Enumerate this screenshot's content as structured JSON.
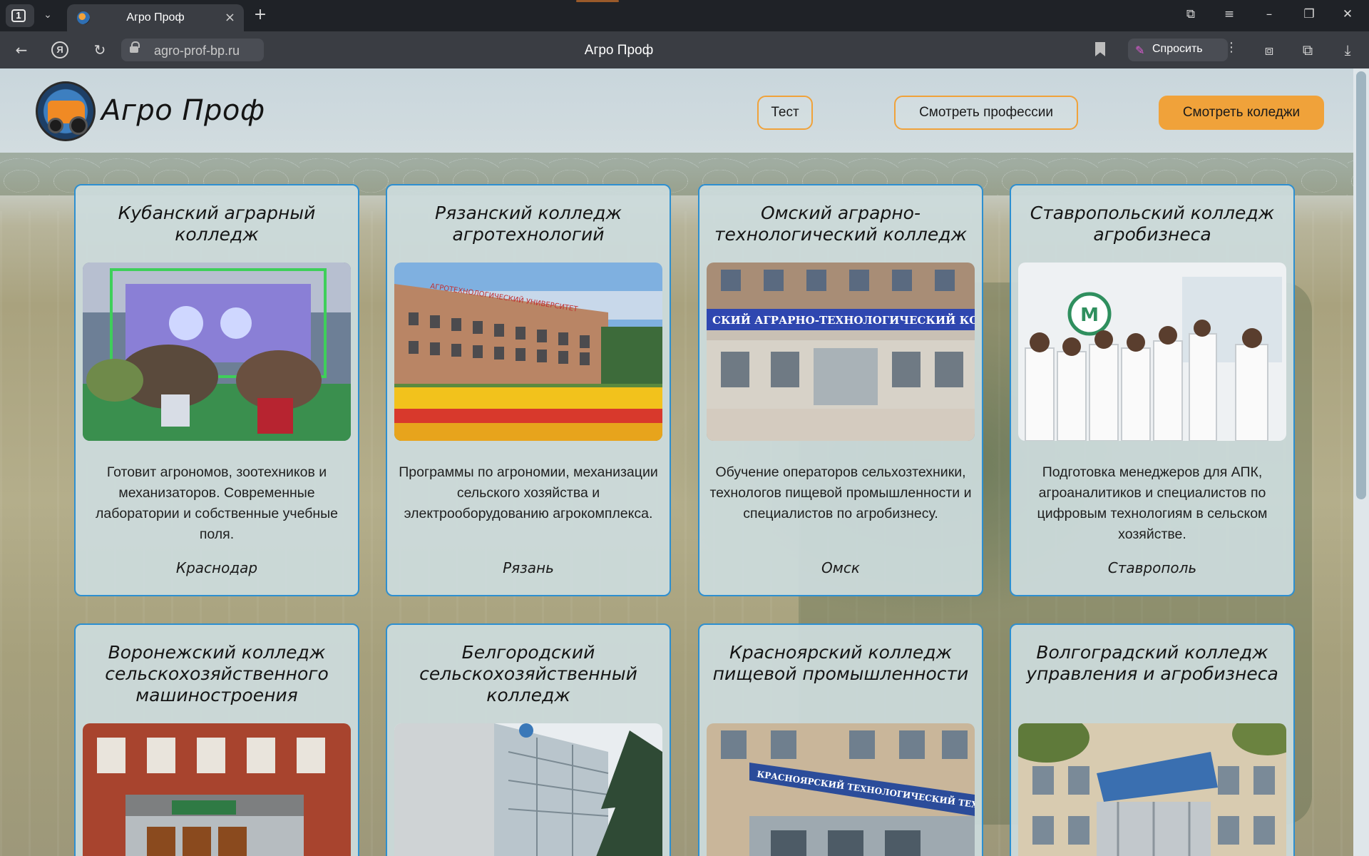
{
  "browser": {
    "tab_count": "1",
    "tab_title": "Агро Проф",
    "url": "agro-prof-bp.ru",
    "page_title": "Агро Проф",
    "ask_label": "Спросить"
  },
  "site": {
    "brand": "Агро Проф",
    "nav": {
      "test": "Тест",
      "professions": "Смотреть профессии",
      "colleges": "Смотреть коледжи"
    }
  },
  "colleges": [
    {
      "title": "Кубанский аграрный колледж",
      "description": "Готовит агрономов, зоотехников и механизаторов. Современные лаборатории и собственные учебные поля.",
      "city": "Краснодар"
    },
    {
      "title": "Рязанский колледж агротехнологий",
      "description": "Программы по агрономии, механизации сельского хозяйства и электрооборудованию агрокомплекса.",
      "city": "Рязань",
      "sign": "АГРОТЕХНОЛОГИЧЕСКИЙ УНИВЕРСИТЕТ"
    },
    {
      "title": "Омский аграрно-технологический колледж",
      "description": "Обучение операторов сельхозтехники, технологов пищевой промышленности и специалистов по агробизнесу.",
      "city": "Омск",
      "sign": "СКИЙ АГРАРНО-ТЕХНОЛОГИЧЕСКИЙ КОЛЛЕДЖ"
    },
    {
      "title": "Ставропольский колледж агробизнеса",
      "description": "Подготовка менеджеров для АПК, агроаналитиков и специалистов по цифровым технологиям в сельском хозяйстве.",
      "city": "Ставрополь",
      "logo_letter": "М"
    },
    {
      "title": "Воронежский колледж сельскохозяйственного машиностроения"
    },
    {
      "title": "Белгородский сельскохозяйственный колледж"
    },
    {
      "title": "Красноярский колледж пищевой промышленности",
      "sign": "КРАСНОЯРСКИЙ ТЕХНОЛОГИЧЕСКИЙ ТЕХНИКУМ ПИЩЕВОЙ ПРОМЫШЛЕННОСТИ"
    },
    {
      "title": "Волгоградский колледж управления и агробизнеса"
    }
  ],
  "colors": {
    "accent": "#f0a23a",
    "card_border": "#2d8fd0",
    "card_bg": "#ccdbdd"
  }
}
